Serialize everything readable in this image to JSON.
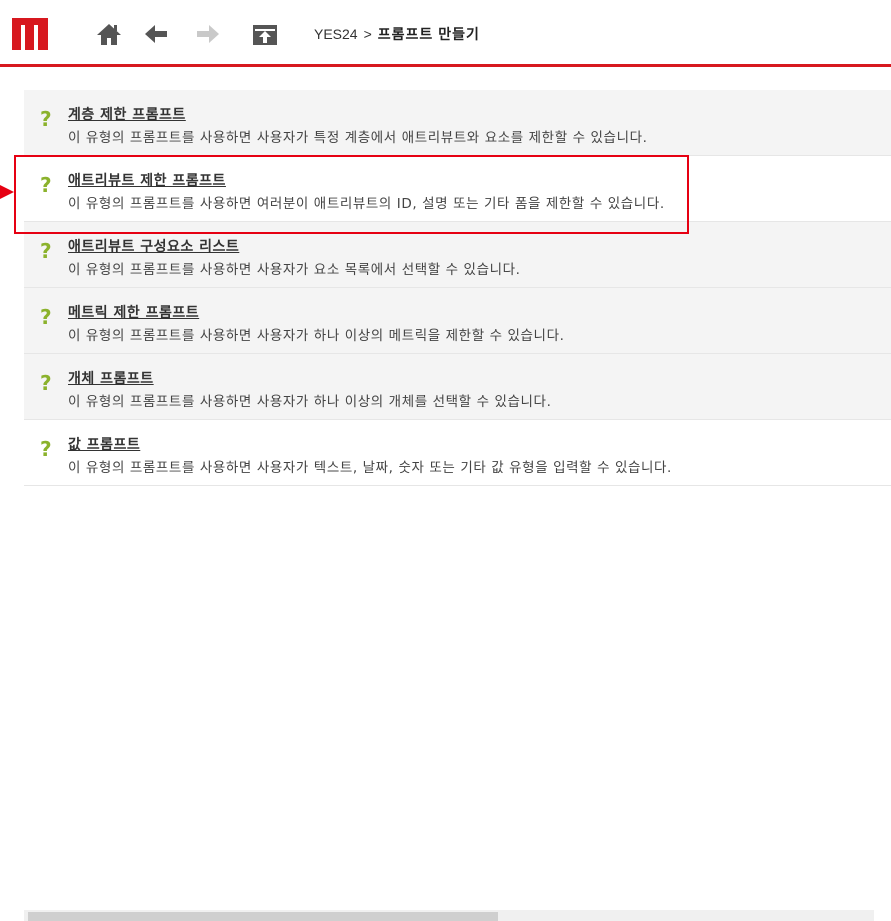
{
  "breadcrumb": {
    "root": "YES24",
    "separator": ">",
    "current": "프롬프트 만들기"
  },
  "toolbar": {
    "icons": [
      "logo-icon",
      "home-icon",
      "back-arrow-icon",
      "forward-arrow-icon",
      "up-folder-icon"
    ]
  },
  "colors": {
    "accent_red": "#d7181f",
    "question_green": "#8bb22c",
    "highlight_red": "#e60012"
  },
  "prompt_types": [
    {
      "title": "계층 제한 프롬프트",
      "description": "이 유형의 프롬프트를 사용하면 사용자가 특정 계층에서 애트리뷰트와 요소를 제한할 수 있습니다."
    },
    {
      "title": "애트리뷰트 제한 프롬프트",
      "description": "이 유형의 프롬프트를 사용하면 여러분이 애트리뷰트의 ID, 설명 또는 기타 폼을 제한할 수 있습니다."
    },
    {
      "title": "애트리뷰트 구성요소 리스트",
      "description": "이 유형의 프롬프트를 사용하면 사용자가 요소 목록에서 선택할 수 있습니다."
    },
    {
      "title": "메트릭 제한 프롬프트",
      "description": "이 유형의 프롬프트를 사용하면 사용자가 하나 이상의 메트릭을 제한할 수 있습니다."
    },
    {
      "title": "개체 프롬프트",
      "description": "이 유형의 프롬프트를 사용하면 사용자가 하나 이상의 개체를 선택할 수 있습니다."
    },
    {
      "title": "값 프롬프트",
      "description": "이 유형의 프롬프트를 사용하면 사용자가 텍스트, 날짜, 숫자 또는 기타 값 유형을 입력할 수 있습니다."
    }
  ],
  "question_mark": "?"
}
